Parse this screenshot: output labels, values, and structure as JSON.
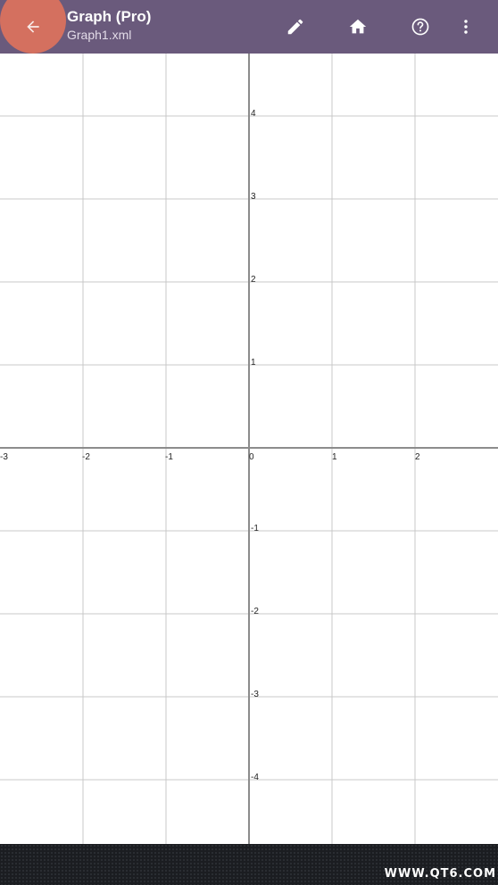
{
  "toolbar": {
    "title": "Graph (Pro)",
    "subtitle": "Graph1.xml",
    "icons": {
      "back": "arrow-back-icon",
      "edit": "pencil-icon",
      "home": "home-icon",
      "help": "help-circle-icon",
      "more": "more-vertical-icon"
    },
    "colors": {
      "background": "#6a5a7c",
      "ripple": "#d4705f"
    }
  },
  "graph": {
    "x_ticks": [
      "-3",
      "-2",
      "-1",
      "0",
      "1",
      "2"
    ],
    "y_ticks_positive": [
      "4",
      "3",
      "2",
      "1"
    ],
    "y_ticks_negative": [
      "-1",
      "-2",
      "-3",
      "-4"
    ],
    "grid_color": "#c8c8c8",
    "axis_color": "#8c8c8c"
  },
  "footer": {
    "watermark": "WWW.QT6.COM"
  }
}
